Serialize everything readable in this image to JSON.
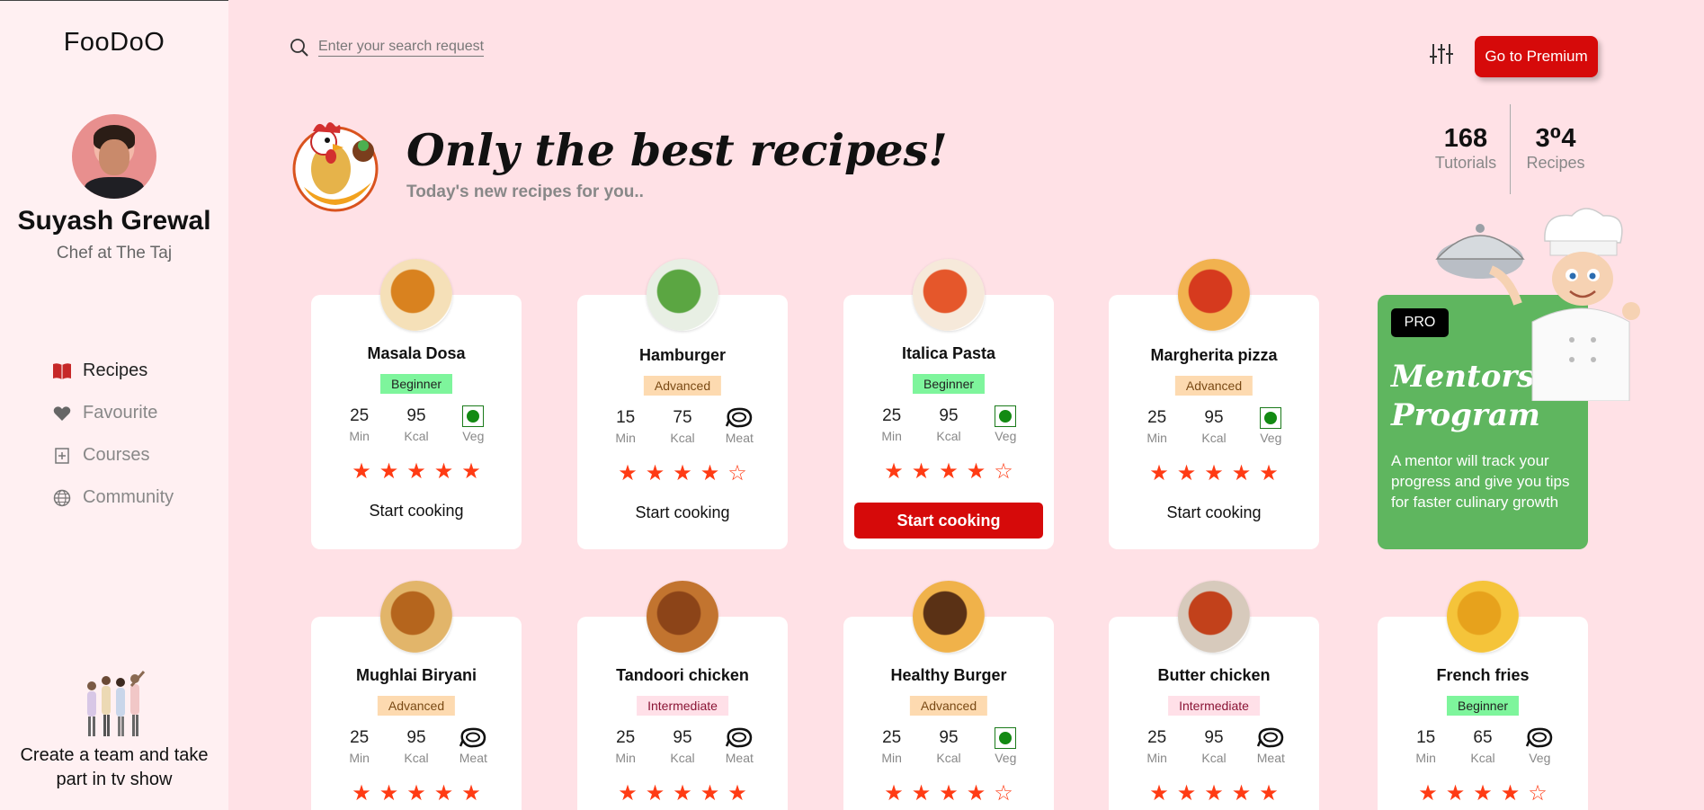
{
  "app": {
    "brand": "FooDoO"
  },
  "user": {
    "name": "Suyash Grewal",
    "role": "Chef at The Taj"
  },
  "nav": [
    {
      "label": "Recipes",
      "icon": "book-icon",
      "active": true
    },
    {
      "label": "Favourite",
      "icon": "heart-icon",
      "active": false
    },
    {
      "label": "Courses",
      "icon": "courses-icon",
      "active": false
    },
    {
      "label": "Community",
      "icon": "globe-icon",
      "active": false
    }
  ],
  "promo": {
    "text": "Create a team and take part in tv show"
  },
  "search": {
    "placeholder": "Enter your search request"
  },
  "premium": {
    "label": "Go to Premium"
  },
  "hero": {
    "title": "Only the best recipes!",
    "subtitle": "Today's new recipes for you.."
  },
  "stats": [
    {
      "value": "168",
      "label": "Tutorials"
    },
    {
      "value": "3⁰4",
      "label": "Recipes"
    }
  ],
  "pro": {
    "badge": "PRO",
    "title": "Mentorship Program",
    "description": "A mentor will track your progress and give you tips for faster culinary growth"
  },
  "colors": {
    "accent": "#d60a0a",
    "star": "#ff3b14",
    "pro_bg": "#5fb65f",
    "page_bg": "#ffe1e6"
  },
  "recipes": [
    {
      "name": "Masala Dosa",
      "level": "Beginner",
      "time": "25",
      "time_unit": "Min",
      "kcal": "95",
      "kcal_unit": "Kcal",
      "type": "Veg",
      "rating": 5,
      "button": "Start cooking",
      "highlight": false
    },
    {
      "name": "Hamburger",
      "level": "Advanced",
      "time": "15",
      "time_unit": "Min",
      "kcal": "75",
      "kcal_unit": "Kcal",
      "type": "Meat",
      "rating": 4,
      "button": "Start cooking",
      "highlight": false
    },
    {
      "name": "Italica Pasta",
      "level": "Beginner",
      "time": "25",
      "time_unit": "Min",
      "kcal": "95",
      "kcal_unit": "Kcal",
      "type": "Veg",
      "rating": 4,
      "button": "Start cooking",
      "highlight": true
    },
    {
      "name": "Margherita pizza",
      "level": "Advanced",
      "time": "25",
      "time_unit": "Min",
      "kcal": "95",
      "kcal_unit": "Kcal",
      "type": "Veg",
      "rating": 5,
      "button": "Start cooking",
      "highlight": false
    },
    {
      "name": "Mughlai Biryani",
      "level": "Advanced",
      "time": "25",
      "time_unit": "Min",
      "kcal": "95",
      "kcal_unit": "Kcal",
      "type": "Meat",
      "rating": 5,
      "button": "",
      "highlight": false
    },
    {
      "name": "Tandoori chicken",
      "level": "Intermediate",
      "time": "25",
      "time_unit": "Min",
      "kcal": "95",
      "kcal_unit": "Kcal",
      "type": "Meat",
      "rating": 5,
      "button": "",
      "highlight": false
    },
    {
      "name": "Healthy Burger",
      "level": "Advanced",
      "time": "25",
      "time_unit": "Min",
      "kcal": "95",
      "kcal_unit": "Kcal",
      "type": "Veg",
      "rating": 4,
      "button": "",
      "highlight": false
    },
    {
      "name": "Butter chicken",
      "level": "Intermediate",
      "time": "25",
      "time_unit": "Min",
      "kcal": "95",
      "kcal_unit": "Kcal",
      "type": "Meat",
      "rating": 5,
      "button": "",
      "highlight": false
    },
    {
      "name": "French fries",
      "level": "Beginner",
      "time": "15",
      "time_unit": "Min",
      "kcal": "65",
      "kcal_unit": "Kcal",
      "type": "Veg",
      "rating": 4,
      "button": "",
      "highlight": false
    }
  ]
}
